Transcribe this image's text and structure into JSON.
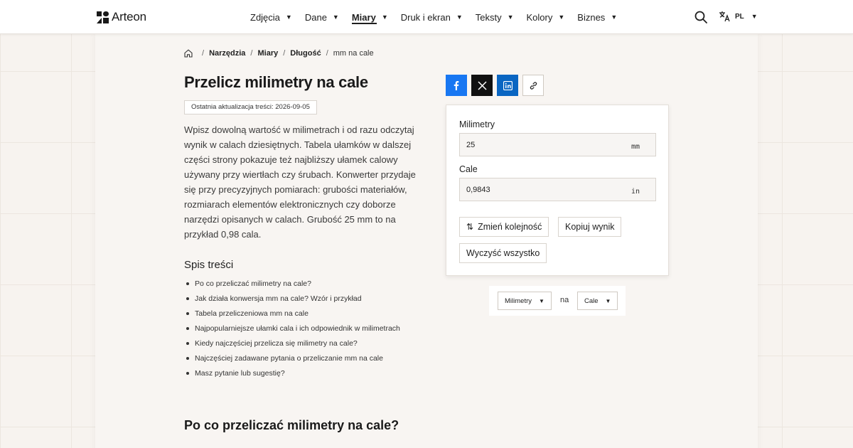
{
  "brand": {
    "name": "Arteon"
  },
  "nav": {
    "items": [
      {
        "label": "Zdjęcia",
        "active": false
      },
      {
        "label": "Dane",
        "active": false
      },
      {
        "label": "Miary",
        "active": true
      },
      {
        "label": "Druk i ekran",
        "active": false
      },
      {
        "label": "Teksty",
        "active": false
      },
      {
        "label": "Kolory",
        "active": false
      },
      {
        "label": "Biznes",
        "active": false
      }
    ],
    "language": "PL",
    "search_icon": "search-icon",
    "language_icon": "translate-icon"
  },
  "breadcrumb": {
    "items": [
      "Narzędzia",
      "Miary",
      "Długość"
    ],
    "current": "mm na cale"
  },
  "page": {
    "title": "Przelicz milimetry na cale",
    "updated": "Ostatnia aktualizacja treści: 2026-09-05",
    "intro": "Wpisz dowolną wartość w milimetrach i od razu odczytaj wynik w calach dziesiętnych. Tabela ułamków w dalszej części strony pokazuje też najbliższy ułamek calowy używany przy wiertłach czy śrubach. Konwerter przydaje się przy precyzyjnych pomiarach: grubości materiałów, rozmiarach elementów elektronicznych czy doborze narzędzi opisanych w calach. Grubość 25 mm to na przykład 0,98 cala.",
    "toc_title": "Spis treści",
    "toc": [
      "Po co przeliczać milimetry na cale?",
      "Jak działa konwersja mm na cale? Wzór i przykład",
      "Tabela przeliczeniowa mm na cale",
      "Najpopularniejsze ułamki cala i ich odpowiednik w milimetrach",
      "Kiedy najczęściej przelicza się milimetry na cale?",
      "Najczęściej zadawane pytania o przeliczanie mm na cale",
      "Masz pytanie lub sugestię?"
    ],
    "section_title": "Po co przeliczać milimetry na cale?"
  },
  "share": {
    "facebook": "facebook-icon",
    "x": "x-icon",
    "linkedin": "linkedin-icon",
    "link": "link-icon",
    "colors": {
      "facebook": "#1877f2",
      "x": "#111111",
      "linkedin": "#0a66c2"
    }
  },
  "converter": {
    "from_label": "Milimetry",
    "from_value": "25",
    "from_unit": "mm",
    "to_label": "Cale",
    "to_value": "0,9843",
    "to_unit": "in",
    "swap_label": "Zmień kolejność",
    "copy_label": "Kopiuj wynik",
    "clear_label": "Wyczyść wszystko"
  },
  "unit_select": {
    "from": "Milimetry",
    "connector": "na",
    "to": "Cale"
  }
}
